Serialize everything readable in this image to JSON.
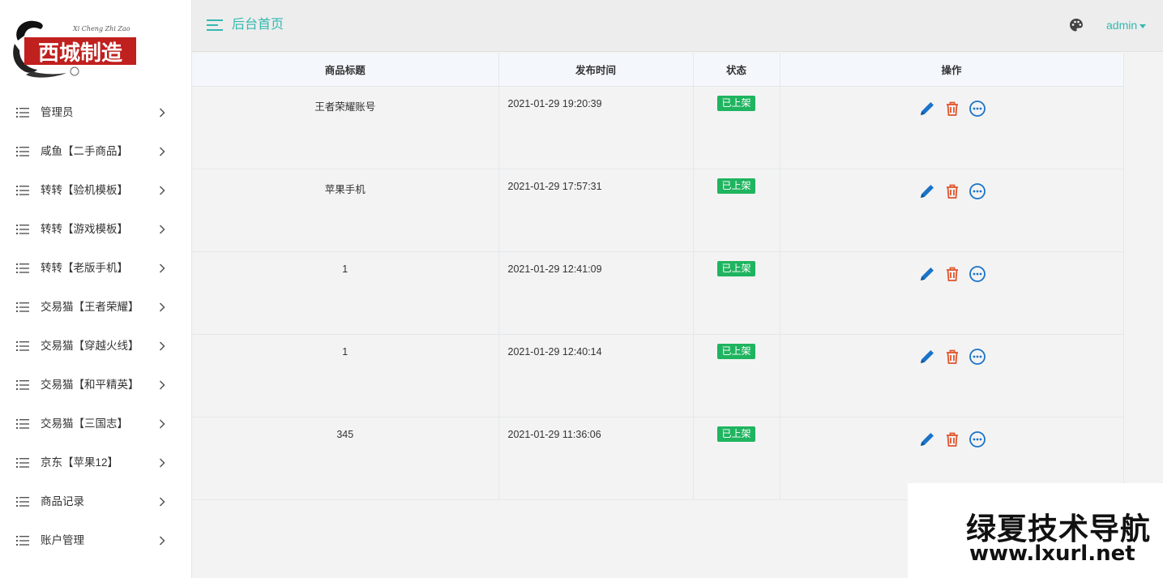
{
  "brand": {
    "logo_text": "西城制造",
    "logo_subtext": "Xi Cheng Zhi Zao"
  },
  "sidebar": {
    "items": [
      {
        "label": "管理员"
      },
      {
        "label": "咸鱼【二手商品】"
      },
      {
        "label": "转转【验机模板】"
      },
      {
        "label": "转转【游戏模板】"
      },
      {
        "label": "转转【老版手机】"
      },
      {
        "label": "交易猫【王者荣耀】"
      },
      {
        "label": "交易猫【穿越火线】"
      },
      {
        "label": "交易猫【和平精英】"
      },
      {
        "label": "交易猫【三国志】"
      },
      {
        "label": "京东【苹果12】"
      },
      {
        "label": "商品记录"
      },
      {
        "label": "账户管理"
      }
    ]
  },
  "header": {
    "title": "后台首页",
    "user": "admin"
  },
  "table": {
    "columns": {
      "title": "商品标题",
      "time": "发布时间",
      "status": "状态",
      "ops": "操作"
    },
    "rows": [
      {
        "title": "王者荣耀账号",
        "time": "2021-01-29 19:20:39",
        "status": "已上架"
      },
      {
        "title": "苹果手机",
        "time": "2021-01-29 17:57:31",
        "status": "已上架"
      },
      {
        "title": "1",
        "time": "2021-01-29 12:41:09",
        "status": "已上架"
      },
      {
        "title": "1",
        "time": "2021-01-29 12:40:14",
        "status": "已上架"
      },
      {
        "title": "345",
        "time": "2021-01-29 11:36:06",
        "status": "已上架"
      }
    ]
  },
  "watermark": {
    "name": "绿夏技术导航",
    "url": "www.lxurl.net"
  },
  "icons": {
    "menu_item": "list-icon",
    "menu_arrow": "chevron-right-icon",
    "header_toggle": "hamburger-icon",
    "theme": "palette-icon",
    "edit": "pencil-icon",
    "delete": "trash-icon",
    "more": "more-circle-icon"
  },
  "colors": {
    "accent": "#33b8b0",
    "status_badge": "#1fb45f",
    "edit_icon": "#1a73c8",
    "delete_icon": "#e0552e",
    "more_icon": "#1a73c8"
  }
}
